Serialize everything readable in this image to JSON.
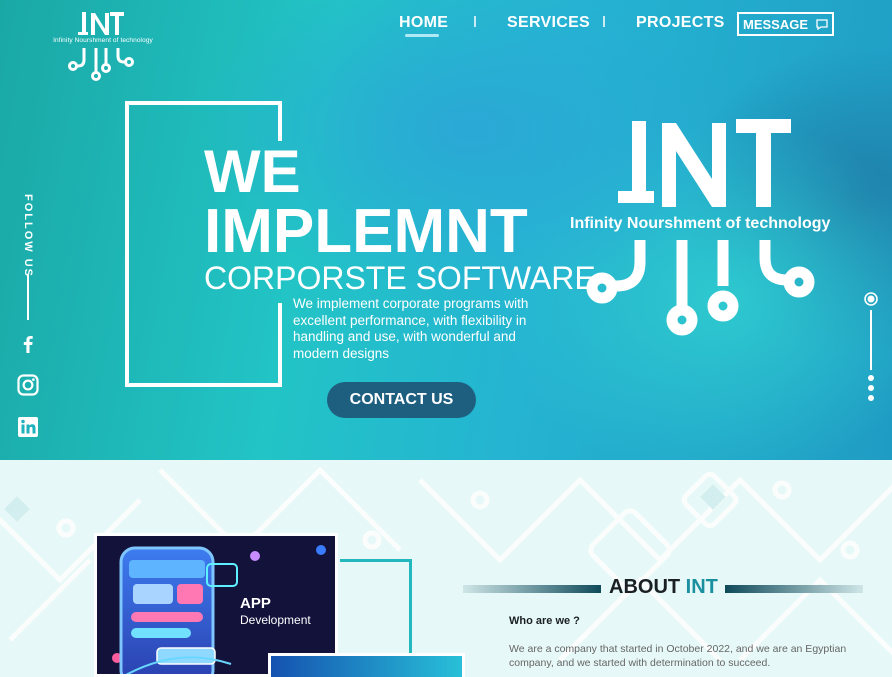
{
  "brand": {
    "logo_text": "INT",
    "tagline_small": "Infinity Nourshment of technology",
    "tagline_large": "Infinity Nourshment of technology"
  },
  "nav": {
    "items": [
      {
        "label": "HOME",
        "active": true
      },
      {
        "label": "SERVICES",
        "active": false
      },
      {
        "label": "PROJECTS",
        "active": false
      }
    ],
    "message_button": "MESSAGE",
    "message_icon": "chat-bubble-icon"
  },
  "social": {
    "follow_label": "FOLLOW US",
    "icons": [
      "facebook-icon",
      "instagram-icon",
      "linkedin-icon"
    ]
  },
  "hero": {
    "line1": "WE",
    "line2": "IMPLEMNT",
    "line3": "CORPORSTE SOFTWARE",
    "description": "We implement corporate programs with excellent performance, with flexibility in handling and use, with wonderful and modern designs",
    "cta": "CONTACT US"
  },
  "about": {
    "title_prefix": "ABOUT",
    "title_highlight": "INT",
    "subtitle": "Who are we ?",
    "text": "We are a company that started in October 2022, and we are an Egyptian company, and we started with determination to succeed.",
    "image_title": "APP",
    "image_subtitle": "Development"
  },
  "colors": {
    "accent": "#1a8fa0",
    "button_dark": "#1e5f80",
    "hero_teal": "#22c4c6"
  }
}
